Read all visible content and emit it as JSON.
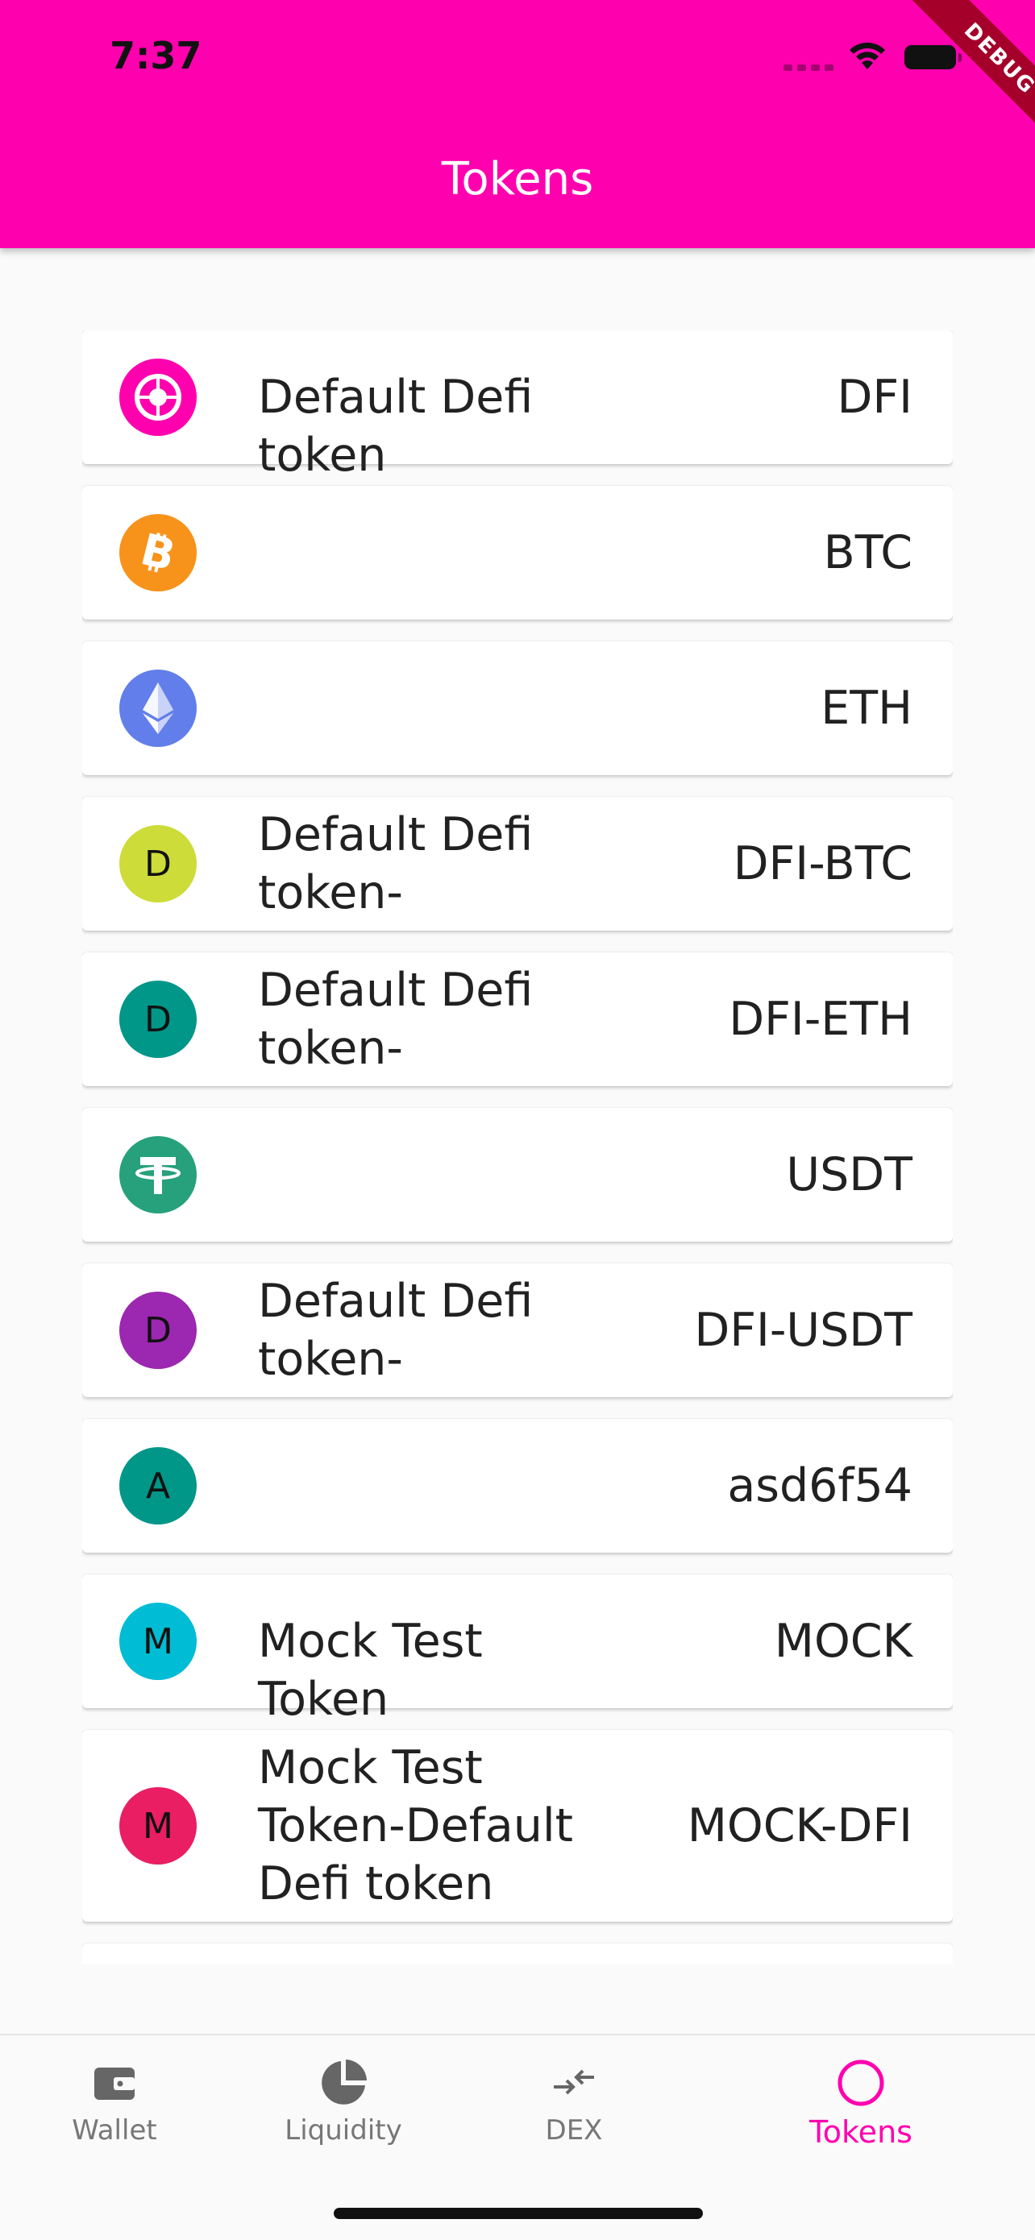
{
  "status_bar": {
    "time": "7:37"
  },
  "debug_banner": "DEBUG",
  "appbar": {
    "title": "Tokens"
  },
  "tokens": [
    {
      "name": "Default Defi token",
      "symbol": "DFI",
      "icon": "dfi-logo-icon",
      "color": "#ff00af"
    },
    {
      "name": "",
      "symbol": "BTC",
      "icon": "bitcoin-icon",
      "color": "#f7931a"
    },
    {
      "name": "",
      "symbol": "ETH",
      "icon": "ethereum-icon",
      "color": "#627eea"
    },
    {
      "name": "Default Defi token-",
      "symbol": "DFI-BTC",
      "icon": "letter-avatar",
      "letter": "D",
      "color": "#cddc39"
    },
    {
      "name": "Default Defi token-",
      "symbol": "DFI-ETH",
      "icon": "letter-avatar",
      "letter": "D",
      "color": "#009688"
    },
    {
      "name": "",
      "symbol": "USDT",
      "icon": "tether-icon",
      "color": "#26a17b"
    },
    {
      "name": "Default Defi token-",
      "symbol": "DFI-USDT",
      "icon": "letter-avatar",
      "letter": "D",
      "color": "#9c27b0"
    },
    {
      "name": "",
      "symbol": "asd6f54",
      "icon": "letter-avatar",
      "letter": "A",
      "color": "#009688"
    },
    {
      "name": "Mock Test Token",
      "symbol": "MOCK",
      "icon": "letter-avatar",
      "letter": "M",
      "color": "#00bcd4"
    },
    {
      "name": "Mock Test Token-Default Defi token",
      "symbol": "MOCK-DFI",
      "icon": "letter-avatar",
      "letter": "M",
      "color": "#e91e63"
    }
  ],
  "bottom_nav": [
    {
      "label": "Wallet",
      "icon": "wallet-icon",
      "active": false
    },
    {
      "label": "Liquidity",
      "icon": "pie-chart-icon",
      "active": false
    },
    {
      "label": "DEX",
      "icon": "swap-arrows-icon",
      "active": false
    },
    {
      "label": "Tokens",
      "icon": "circle-icon",
      "active": true
    }
  ],
  "colors": {
    "accent": "#ff00af",
    "inactive_nav": "#777777"
  }
}
